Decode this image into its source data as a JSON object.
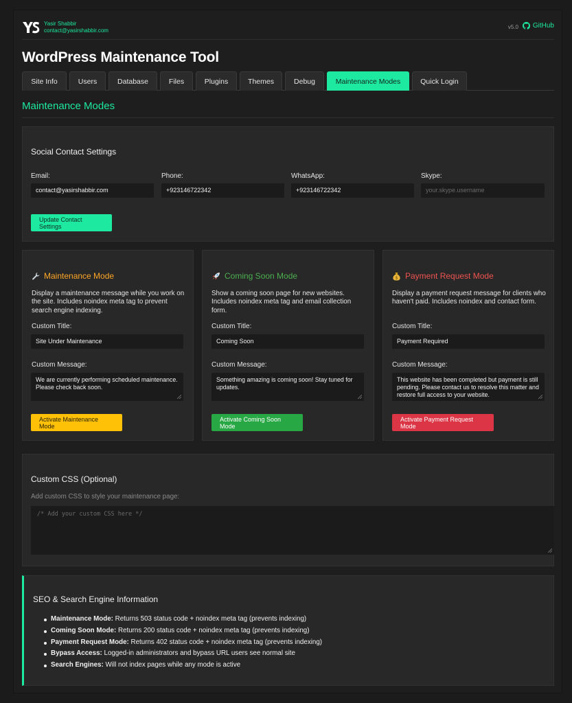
{
  "header": {
    "author_name": "Yasir Shabbir",
    "author_email": "contact@yasirshabbir.com",
    "version": "v5.0",
    "github_label": "GitHub"
  },
  "title": "WordPress Maintenance Tool",
  "tabs": [
    {
      "label": "Site Info"
    },
    {
      "label": "Users"
    },
    {
      "label": "Database"
    },
    {
      "label": "Files"
    },
    {
      "label": "Plugins"
    },
    {
      "label": "Themes"
    },
    {
      "label": "Debug"
    },
    {
      "label": "Maintenance Modes",
      "active": true
    },
    {
      "label": "Quick Login"
    }
  ],
  "section_title": "Maintenance Modes",
  "contact": {
    "title": "Social Contact Settings",
    "email_label": "Email:",
    "email_value": "contact@yasirshabbir.com",
    "phone_label": "Phone:",
    "phone_value": "+923146722342",
    "whatsapp_label": "WhatsApp:",
    "whatsapp_value": "+923146722342",
    "skype_label": "Skype:",
    "skype_placeholder": "your.skype.username",
    "update_button": "Update Contact Settings"
  },
  "modes": {
    "maintenance": {
      "icon": "wrench-icon",
      "title": "Maintenance Mode",
      "color": "#ffa726",
      "description": "Display a maintenance message while you work on the site. Includes noindex meta tag to prevent search engine indexing.",
      "custom_title_label": "Custom Title:",
      "custom_title_value": "Site Under Maintenance",
      "custom_message_label": "Custom Message:",
      "custom_message_value": "We are currently performing scheduled maintenance. Please check back soon.",
      "button": "Activate Maintenance Mode"
    },
    "coming_soon": {
      "icon": "rocket-icon",
      "title": "Coming Soon Mode",
      "color": "#4caf50",
      "description": "Show a coming soon page for new websites. Includes noindex meta tag and email collection form.",
      "custom_title_label": "Custom Title:",
      "custom_title_value": "Coming Soon",
      "custom_message_label": "Custom Message:",
      "custom_message_value": "Something amazing is coming soon! Stay tuned for updates.",
      "button": "Activate Coming Soon Mode"
    },
    "payment": {
      "icon": "money-bag-icon",
      "title": "Payment Request Mode",
      "color": "#ef5350",
      "description": "Display a payment request message for clients who haven't paid. Includes noindex and contact form.",
      "custom_title_label": "Custom Title:",
      "custom_title_value": "Payment Required",
      "custom_message_label": "Custom Message:",
      "custom_message_value": "This website has been completed but payment is still pending. Please contact us to resolve this matter and restore full access to your website.",
      "button": "Activate Payment Request Mode"
    }
  },
  "custom_css": {
    "title": "Custom CSS (Optional)",
    "help": "Add custom CSS to style your maintenance page:",
    "placeholder": "/* Add your custom CSS here */"
  },
  "seo": {
    "title": "SEO & Search Engine Information",
    "items": [
      {
        "term": "Maintenance Mode:",
        "text": " Returns 503 status code + noindex meta tag (prevents indexing)"
      },
      {
        "term": "Coming Soon Mode:",
        "text": " Returns 200 status code + noindex meta tag (prevents indexing)"
      },
      {
        "term": "Payment Request Mode:",
        "text": " Returns 402 status code + noindex meta tag (prevents indexing)"
      },
      {
        "term": "Bypass Access:",
        "text": " Logged-in administrators and bypass URL users see normal site"
      },
      {
        "term": "Search Engines:",
        "text": " Will not index pages while any mode is active"
      }
    ]
  },
  "colors": {
    "accent": "#1de9a0",
    "maintenance_button": "#ffc107",
    "coming_soon_button": "#28a745",
    "payment_button": "#dc3545"
  }
}
